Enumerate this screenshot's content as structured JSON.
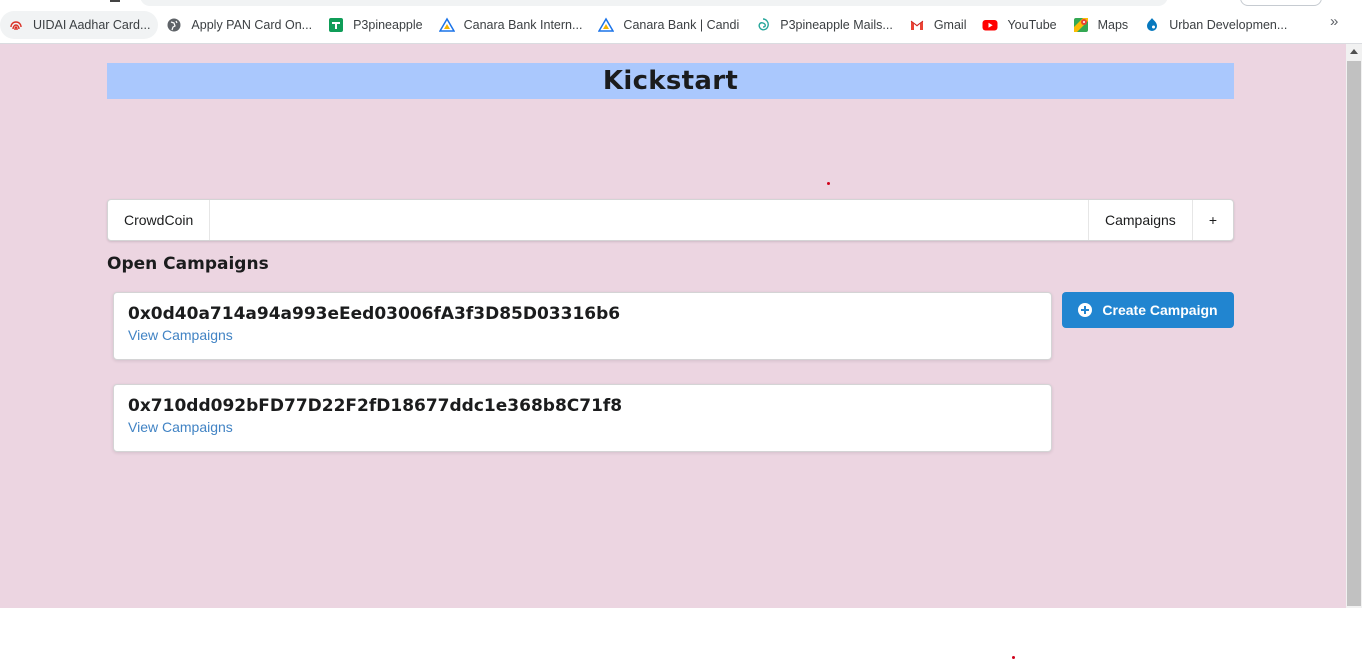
{
  "bookmarks": {
    "items": [
      {
        "label": "UIDAI Aadhar Card...",
        "icon": "fingerprint-icon",
        "color": "#d93025"
      },
      {
        "label": "Apply PAN Card On...",
        "icon": "globe-icon",
        "color": "#5f6368"
      },
      {
        "label": "P3pineapple",
        "icon": "sheets-icon",
        "color": "#0f9d58"
      },
      {
        "label": "Canara Bank Intern...",
        "icon": "canara-icon",
        "color": "#1a73e8"
      },
      {
        "label": "Canara Bank | Candi",
        "icon": "canara-icon",
        "color": "#1a73e8"
      },
      {
        "label": "P3pineapple Mails...",
        "icon": "swirl-icon",
        "color": "#26a69a"
      },
      {
        "label": "Gmail",
        "icon": "gmail-icon",
        "color": "#ea4335"
      },
      {
        "label": "YouTube",
        "icon": "youtube-icon",
        "color": "#ff0000"
      },
      {
        "label": "Maps",
        "icon": "maps-icon",
        "color": "#34a853"
      },
      {
        "label": "Urban Developmen...",
        "icon": "drupal-icon",
        "color": "#0678be"
      }
    ],
    "more": "»"
  },
  "page": {
    "banner_title": "Kickstart",
    "banner_color": "#aac8fd",
    "background_color": "#ecd5e1"
  },
  "menu": {
    "brand": "CrowdCoin",
    "campaigns": "Campaigns",
    "add": "+"
  },
  "main": {
    "section_title": "Open Campaigns",
    "campaigns": [
      {
        "address": "0x0d40a714a94a993eEed03006fA3f3D85D03316b6",
        "link": "View Campaigns"
      },
      {
        "address": "0x710dd092bFD77D22F2fD18677ddc1e368b8C71f8",
        "link": "View Campaigns"
      }
    ],
    "create_button": "Create Campaign",
    "button_color": "#2185d0"
  }
}
